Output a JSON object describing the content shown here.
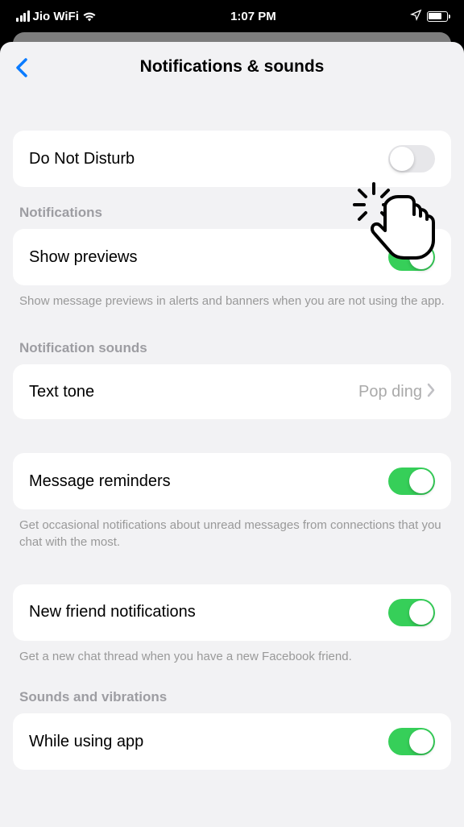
{
  "statusBar": {
    "carrier": "Jio WiFi",
    "time": "1:07 PM"
  },
  "header": {
    "title": "Notifications & sounds"
  },
  "dnd": {
    "label": "Do Not Disturb",
    "on": false
  },
  "sections": {
    "notifications": {
      "header": "Notifications",
      "showPreviews": {
        "label": "Show previews",
        "on": true
      },
      "footer": "Show message previews in alerts and banners when you are not using the app."
    },
    "notificationSounds": {
      "header": "Notification sounds",
      "textTone": {
        "label": "Text tone",
        "value": "Pop ding"
      }
    },
    "messageReminders": {
      "label": "Message reminders",
      "on": true,
      "footer": "Get occasional notifications about unread messages from connections that you chat with the most."
    },
    "newFriend": {
      "label": "New friend notifications",
      "on": true,
      "footer": "Get a new chat thread when you have a new Facebook friend."
    },
    "soundsVibrations": {
      "header": "Sounds and vibrations",
      "whileUsing": {
        "label": "While using app",
        "on": true
      }
    }
  }
}
